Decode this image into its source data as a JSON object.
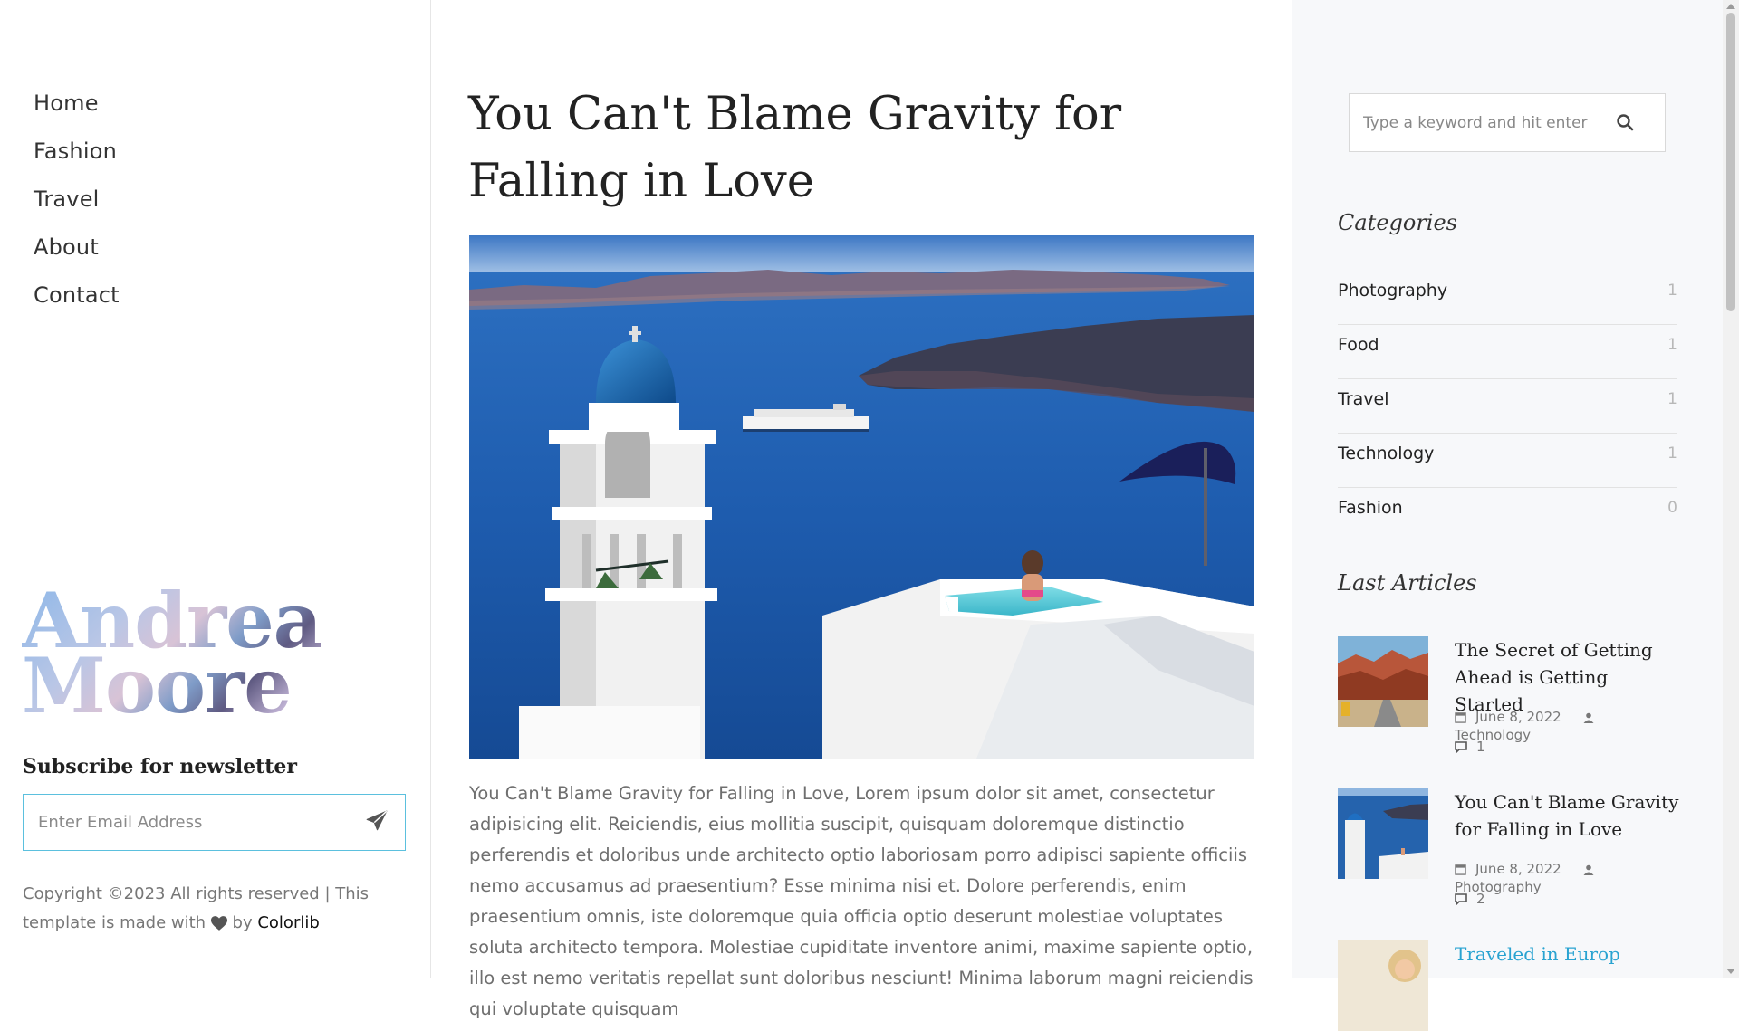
{
  "nav": {
    "items": [
      {
        "label": "Home"
      },
      {
        "label": "Fashion"
      },
      {
        "label": "Travel"
      },
      {
        "label": "About"
      },
      {
        "label": "Contact"
      }
    ]
  },
  "logo": {
    "line1": "Andrea",
    "line2": "Moore"
  },
  "newsletter": {
    "title": "Subscribe for newsletter",
    "placeholder": "Enter Email Address"
  },
  "footer": {
    "copyright_prefix": "Copyright ©2023 All rights reserved | This template is made with",
    "by": "by",
    "brand": "Colorlib"
  },
  "post": {
    "title": "You Can't Blame Gravity for Falling in Love",
    "body": "You Can't Blame Gravity for Falling in Love, Lorem ipsum dolor sit amet, consectetur adipisicing elit. Reiciendis, eius mollitia suscipit, quisquam doloremque distinctio perferendis et doloribus unde architecto optio laboriosam porro adipisci sapiente officiis nemo accusamus ad praesentium? Esse minima nisi et. Dolore perferendis, enim praesentium omnis, iste doloremque quia officia optio deserunt molestiae voluptates soluta architecto tempora. Molestiae cupiditate inventore animi, maxime sapiente optio, illo est nemo veritatis repellat sunt doloribus nesciunt! Minima laborum magni reiciendis qui voluptate quisquam"
  },
  "search": {
    "placeholder": "Type a keyword and hit enter"
  },
  "categories": {
    "heading": "Categories",
    "items": [
      {
        "name": "Photography",
        "count": "1"
      },
      {
        "name": "Food",
        "count": "1"
      },
      {
        "name": "Travel",
        "count": "1"
      },
      {
        "name": "Technology",
        "count": "1"
      },
      {
        "name": "Fashion",
        "count": "0"
      }
    ]
  },
  "last_articles": {
    "heading": "Last Articles",
    "items": [
      {
        "title": "The Secret of Getting Ahead is Getting Started",
        "date": "June 8, 2022",
        "category": "Technology",
        "comments": "1"
      },
      {
        "title": "You Can't Blame Gravity for Falling in Love",
        "date": "June 8, 2022",
        "category": "Photography",
        "comments": "2"
      },
      {
        "title": "Traveled in Europ"
      }
    ]
  },
  "colors": {
    "accent": "#5bc0de",
    "link_active": "#29a3d1",
    "sidebar_bg": "#f7f8fa"
  }
}
